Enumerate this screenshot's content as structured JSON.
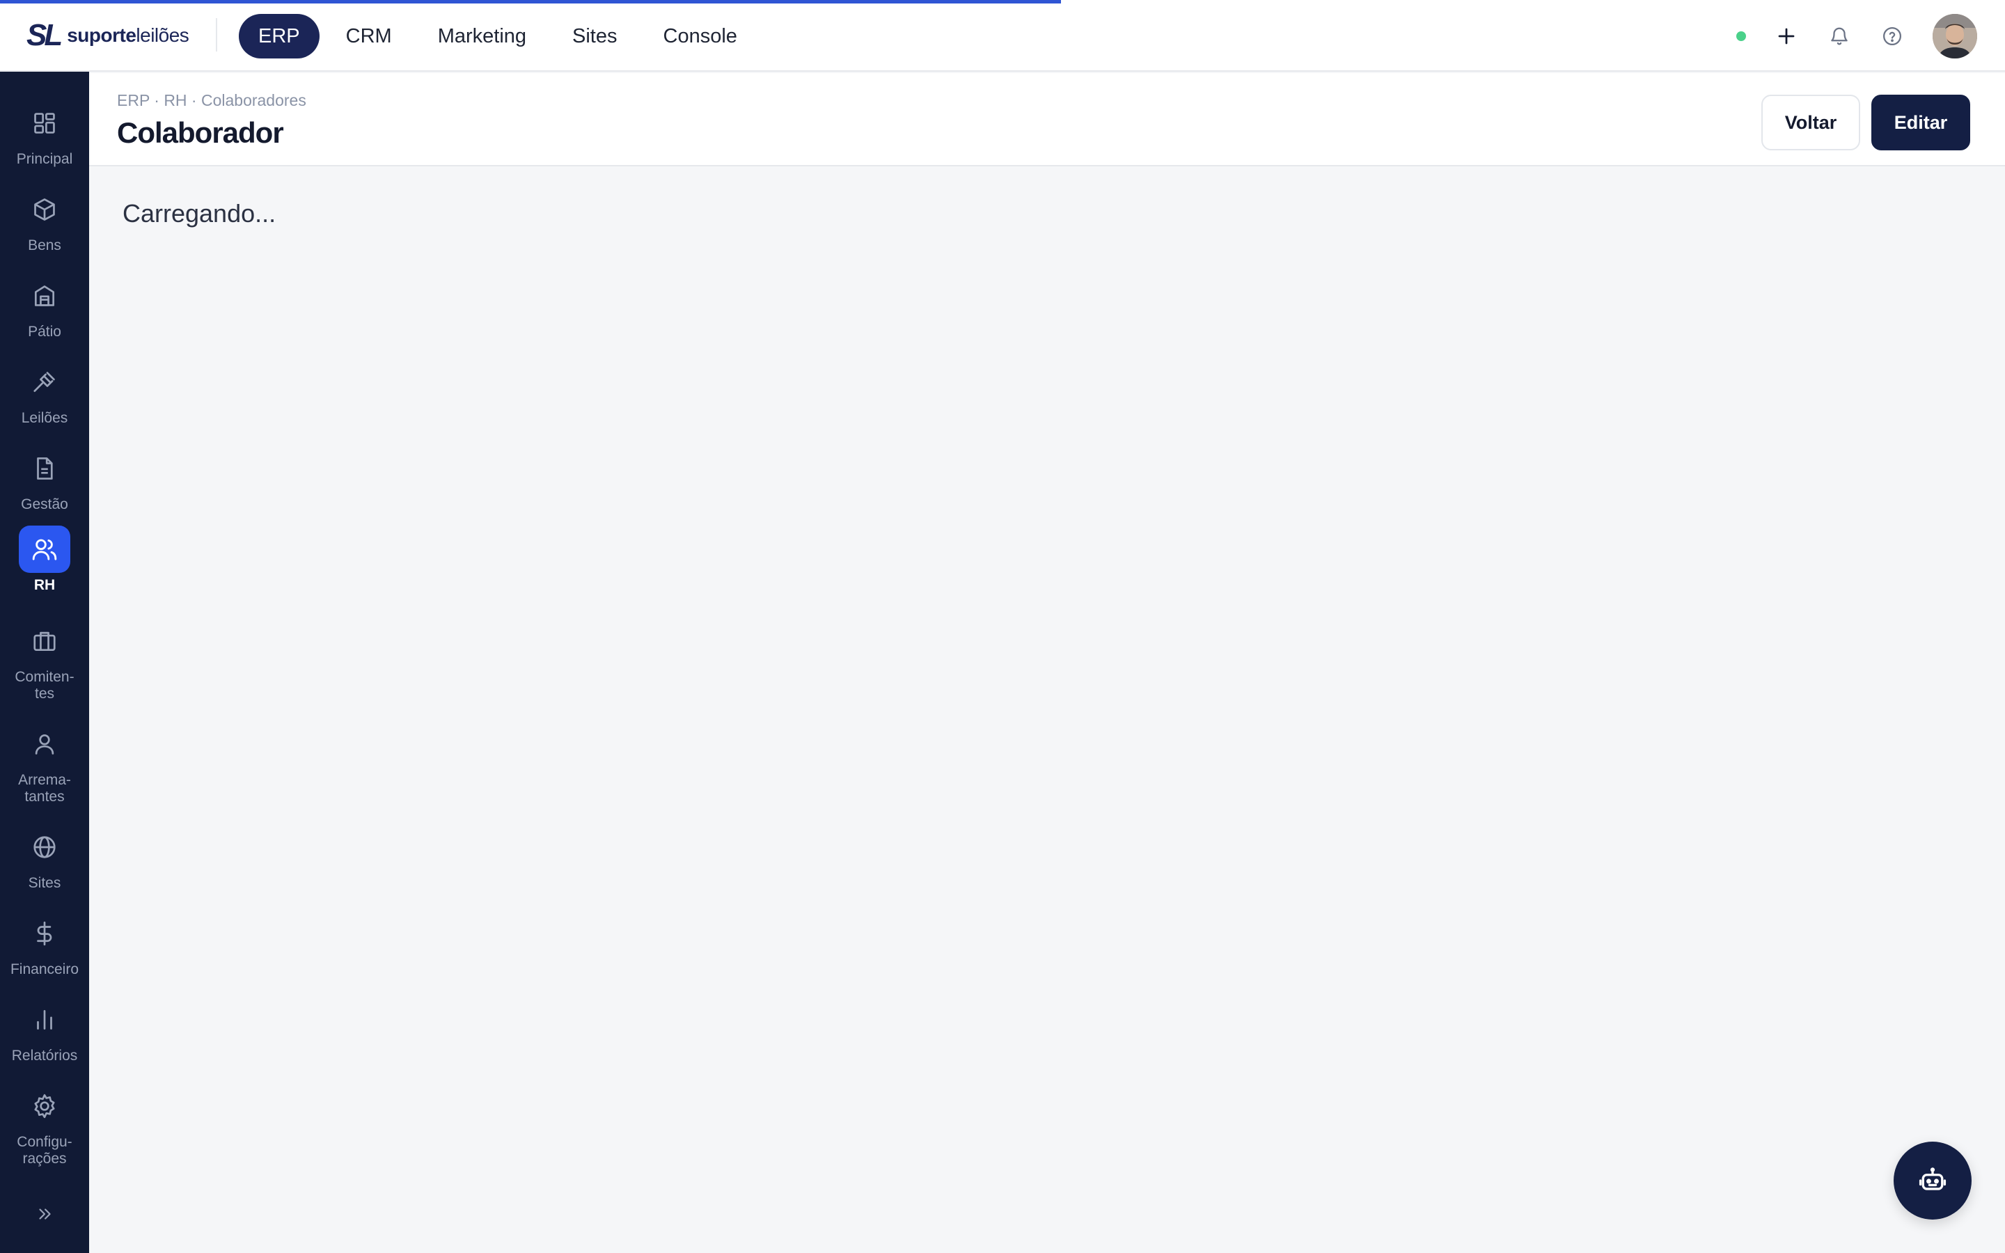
{
  "app": {
    "logo_mark": "SL",
    "logo_text_bold": "suporte",
    "logo_text_light": "leilões"
  },
  "modules": [
    {
      "label": "ERP",
      "active": true
    },
    {
      "label": "CRM",
      "active": false
    },
    {
      "label": "Marketing",
      "active": false
    },
    {
      "label": "Sites",
      "active": false
    },
    {
      "label": "Console",
      "active": false
    }
  ],
  "top_actions": {
    "status_color": "#4ad18a",
    "icons": [
      "plus-icon",
      "bell-icon",
      "help-icon"
    ]
  },
  "sidebar": {
    "items": [
      {
        "label": "Principal",
        "icon": "grid-icon",
        "active": false
      },
      {
        "label": "Bens",
        "icon": "box-icon",
        "active": false
      },
      {
        "label": "Pátio",
        "icon": "building-icon",
        "active": false
      },
      {
        "label": "Leilões",
        "icon": "gavel-icon",
        "active": false
      },
      {
        "label": "Gestão",
        "icon": "document-icon",
        "active": false
      },
      {
        "label": "RH",
        "icon": "users-icon",
        "active": true
      },
      {
        "label": "Comiten-\ntes",
        "icon": "briefcase-icon",
        "active": false
      },
      {
        "label": "Arrema-\ntantes",
        "icon": "user-icon",
        "active": false
      },
      {
        "label": "Sites",
        "icon": "globe-icon",
        "active": false
      },
      {
        "label": "Financeiro",
        "icon": "dollar-icon",
        "active": false
      },
      {
        "label": "Relatórios",
        "icon": "bar-chart-icon",
        "active": false
      },
      {
        "label": "Configu-\nrações",
        "icon": "gear-icon",
        "active": false
      }
    ],
    "collapse_icon": "chevrons-right-icon"
  },
  "header": {
    "breadcrumb": "ERP · RH · Colaboradores",
    "title": "Colaborador",
    "back_label": "Voltar",
    "edit_label": "Editar"
  },
  "main": {
    "loading_text": "Carregando..."
  },
  "colors": {
    "brand_dark": "#141f44",
    "sidebar_bg": "#111a35",
    "active_accent": "#2b57f0",
    "progress": "#2f55d4"
  }
}
